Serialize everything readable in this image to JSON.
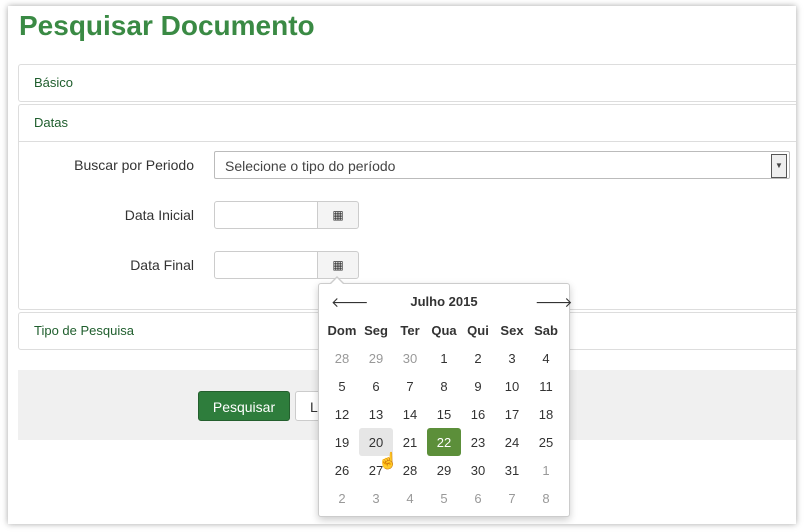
{
  "page": {
    "title": "Pesquisar Documento"
  },
  "panels": {
    "basic": "Básico",
    "dates": "Datas",
    "search_type": "Tipo de Pesquisa"
  },
  "form": {
    "period_label": "Buscar por Periodo",
    "period_select": "Selecione o tipo do período",
    "start_label": "Data Inicial",
    "end_label": "Data Final"
  },
  "buttons": {
    "search": "Pesquisar",
    "clear": "L"
  },
  "datepicker": {
    "month": "Julho 2015",
    "prev": "🡐",
    "next": "🡒",
    "weekdays": [
      "Dom",
      "Seg",
      "Ter",
      "Qua",
      "Qui",
      "Sex",
      "Sab"
    ],
    "weeks": [
      [
        "28",
        "29",
        "30",
        "1",
        "2",
        "3",
        "4"
      ],
      [
        "5",
        "6",
        "7",
        "8",
        "9",
        "10",
        "11"
      ],
      [
        "12",
        "13",
        "14",
        "15",
        "16",
        "17",
        "18"
      ],
      [
        "19",
        "20",
        "21",
        "22",
        "23",
        "24",
        "25"
      ],
      [
        "26",
        "27",
        "28",
        "29",
        "30",
        "31",
        "1"
      ],
      [
        "2",
        "3",
        "4",
        "5",
        "6",
        "7",
        "8"
      ]
    ],
    "selected": "22",
    "hover": "20"
  },
  "icons": {
    "calendar": "calendar-icon",
    "cursor": "hand-pointer-icon"
  }
}
